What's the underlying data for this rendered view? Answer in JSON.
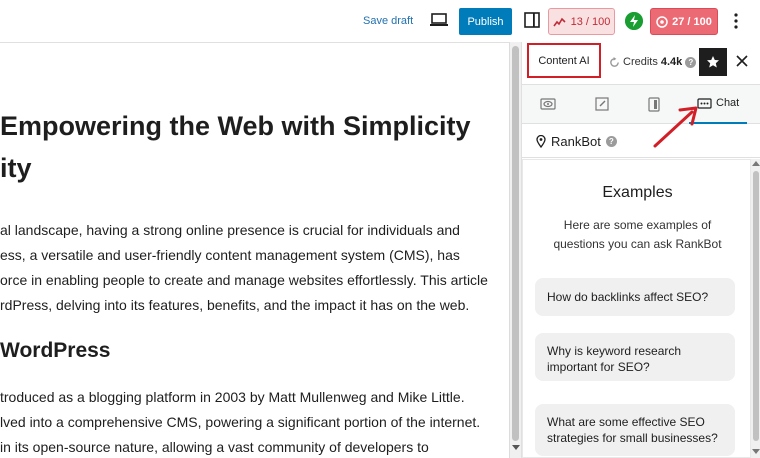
{
  "toolbar": {
    "save_draft": "Save draft",
    "publish": "Publish",
    "score_a": "13 / 100",
    "score_b": "27 / 100"
  },
  "editor": {
    "title_line1": "Empowering the Web with Simplicity",
    "title_line2": "ity",
    "para1": [
      "al landscape, having a strong online presence is crucial for individuals and",
      "ess, a versatile and user-friendly content management system (CMS), has",
      "orce in enabling people to create and manage websites effortlessly. This article",
      "rdPress, delving into its features, benefits, and the impact it has on the web."
    ],
    "heading2": "WordPress",
    "para2": [
      "troduced as a blogging platform in 2003 by Matt Mullenweg and Mike Little.",
      "lved into a comprehensive CMS, powering a significant portion of the internet.",
      " in its open-source nature, allowing a vast community of developers to"
    ]
  },
  "sidebar": {
    "tab_content_ai": "Content AI",
    "credits_label": "Credits",
    "credits_value": "4.4k",
    "chat_tab": "Chat",
    "rankbot": "RankBot",
    "examples_title": "Examples",
    "examples_desc": "Here are some examples of questions you can ask RankBot",
    "examples": [
      "How do backlinks affect SEO?",
      "Why is keyword research important for SEO?",
      "What are some effective SEO strategies for small businesses?"
    ]
  },
  "colors": {
    "accent": "#007cba",
    "highlight_red": "#d21f27",
    "score_bad": "#ec6a74",
    "perf_green": "#1a9e31"
  },
  "icons": [
    "preview-icon",
    "settings-panel-icon",
    "rank-math-icon",
    "performance-icon",
    "more-options-icon",
    "refresh-icon",
    "help-icon",
    "star-icon",
    "close-icon",
    "eye-icon",
    "edit-icon",
    "clipboard-icon",
    "chat-icon",
    "location-pin-icon"
  ]
}
